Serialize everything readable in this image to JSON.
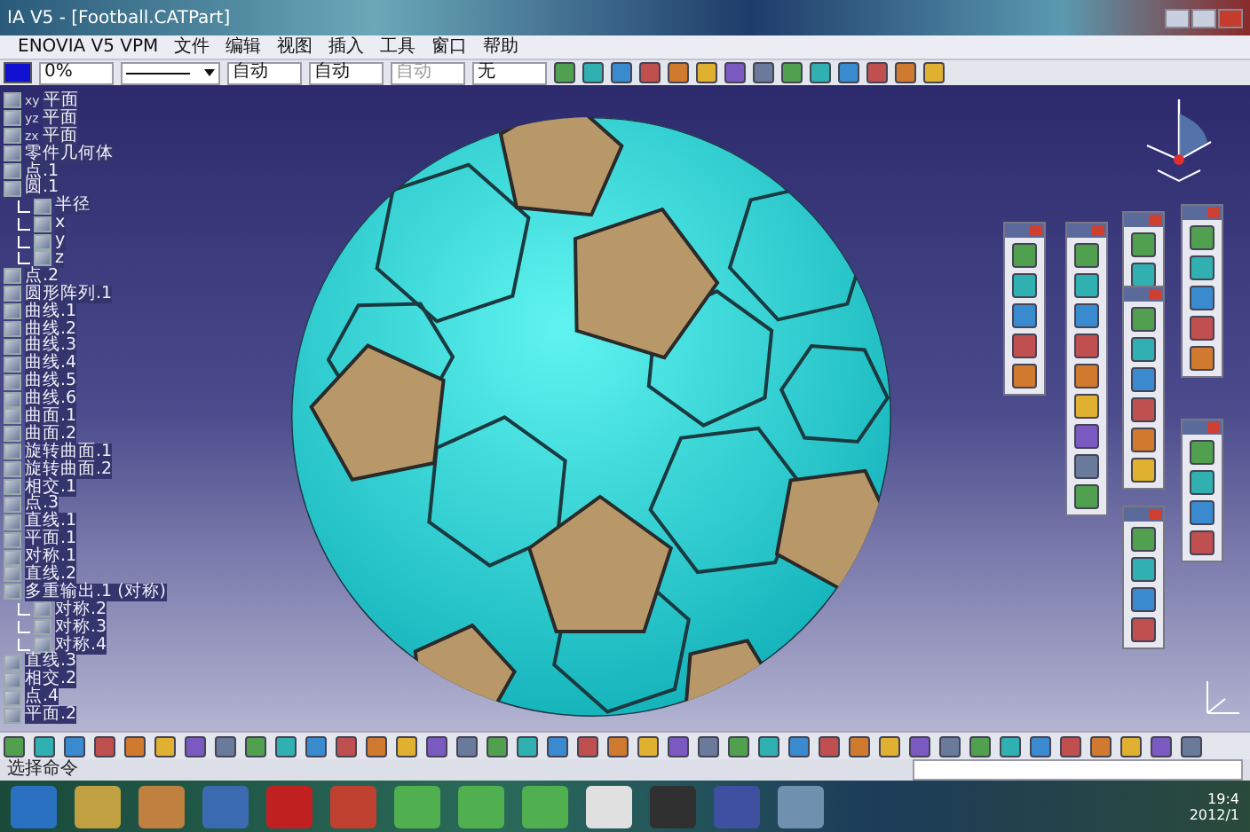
{
  "window": {
    "title": "IA V5 - [Football.CATPart]"
  },
  "menu": [
    "ENOVIA V5 VPM",
    "文件",
    "编辑",
    "视图",
    "插入",
    "工具",
    "窗口",
    "帮助"
  ],
  "format_bar": [
    {
      "kind": "swatch"
    },
    {
      "kind": "text",
      "value": "0%",
      "disabled": false
    },
    {
      "kind": "line"
    },
    {
      "kind": "text",
      "value": "自动",
      "disabled": false
    },
    {
      "kind": "text",
      "value": "自动",
      "disabled": false
    },
    {
      "kind": "text",
      "value": "自动",
      "disabled": true
    },
    {
      "kind": "text",
      "value": "无",
      "disabled": false
    }
  ],
  "tree": [
    {
      "prefix": "xy",
      "label": "平面"
    },
    {
      "prefix": "yz",
      "label": "平面"
    },
    {
      "prefix": "zx",
      "label": "平面"
    },
    {
      "label": "零件几何体"
    },
    {
      "label": "点.1"
    },
    {
      "label": "圆.1",
      "children": [
        {
          "label": "半径"
        },
        {
          "label": "x"
        },
        {
          "label": "y"
        },
        {
          "label": "z"
        }
      ]
    },
    {
      "label": "点.2"
    },
    {
      "label": "圆形阵列.1"
    },
    {
      "label": "曲线.1"
    },
    {
      "label": "曲线.2"
    },
    {
      "label": "曲线.3"
    },
    {
      "label": "曲线.4"
    },
    {
      "label": "曲线.5"
    },
    {
      "label": "曲线.6"
    },
    {
      "label": "曲面.1"
    },
    {
      "label": "曲面.2"
    },
    {
      "label": "旋转曲面.1"
    },
    {
      "label": "旋转曲面.2"
    },
    {
      "label": "相交.1"
    },
    {
      "label": "点.3"
    },
    {
      "label": "直线.1"
    },
    {
      "label": "平面.1"
    },
    {
      "label": "对称.1"
    },
    {
      "label": "直线.2"
    },
    {
      "label": "多重输出.1 (对称)",
      "children": [
        {
          "label": "对称.2"
        },
        {
          "label": "对称.3"
        },
        {
          "label": "对称.4"
        }
      ]
    },
    {
      "label": "直线.3"
    },
    {
      "label": "相交.2"
    },
    {
      "label": "点.4"
    },
    {
      "label": "平面.2"
    }
  ],
  "status_bar": {
    "prompt": "选择命令"
  },
  "taskbar": {
    "time": "19:4",
    "date": "2012/1"
  }
}
